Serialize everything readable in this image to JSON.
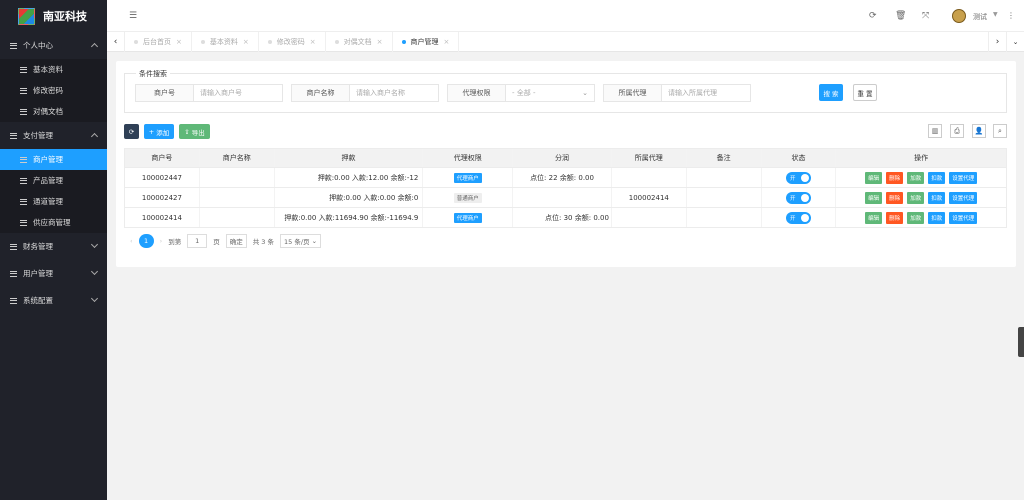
{
  "app": {
    "title": "南亚科技"
  },
  "sidebar": {
    "groups": [
      {
        "label": "个人中心",
        "expanded": true,
        "items": [
          {
            "label": "基本资料"
          },
          {
            "label": "修改密码"
          },
          {
            "label": "对偶文档"
          }
        ]
      },
      {
        "label": "支付管理",
        "expanded": true,
        "items": [
          {
            "label": "商户管理",
            "active": true
          },
          {
            "label": "产品管理"
          },
          {
            "label": "通道管理"
          },
          {
            "label": "供应商管理"
          }
        ]
      },
      {
        "label": "财务管理",
        "expanded": false
      },
      {
        "label": "用户管理",
        "expanded": false
      },
      {
        "label": "系统配置",
        "expanded": false
      }
    ]
  },
  "topbar": {
    "user": "测试"
  },
  "tabs": [
    {
      "label": "后台首页"
    },
    {
      "label": "基本资料"
    },
    {
      "label": "修改密码"
    },
    {
      "label": "对偶文档"
    },
    {
      "label": "商户管理",
      "active": true
    }
  ],
  "search": {
    "legend": "条件搜索",
    "merchant_no": {
      "label": "商户号",
      "placeholder": "请输入商户号"
    },
    "merchant_name": {
      "label": "商户名称",
      "placeholder": "请输入商户名称"
    },
    "agent_perm": {
      "label": "代理权限",
      "value": "- 全部 -"
    },
    "agent": {
      "label": "所属代理",
      "placeholder": "请输入所属代理"
    },
    "search_btn": "搜 索",
    "reset_btn": "重 置"
  },
  "toolbar": {
    "add": "添加",
    "export": "导出"
  },
  "table": {
    "headers": [
      "商户号",
      "商户名称",
      "押款",
      "代理权限",
      "分润",
      "所属代理",
      "备注",
      "状态",
      "操作"
    ],
    "rows": [
      {
        "no": "100002447",
        "name": "",
        "deposit": "押款:0.00 入款:12.00 余额:-12",
        "perm": "代理商户",
        "perm_type": "blue",
        "profit": "点位: 22 余额: 0.00",
        "agent": "",
        "remark": "",
        "status": "开"
      },
      {
        "no": "100002427",
        "name": "",
        "deposit": "押款:0.00 入款:0.00 余额:0",
        "perm": "普通商户",
        "perm_type": "grey",
        "profit": "",
        "agent": "100002414",
        "remark": "",
        "status": "开"
      },
      {
        "no": "100002414",
        "name": "",
        "deposit": "押款:0.00 入款:11694.90 余额:-11694.9",
        "perm": "代理商户",
        "perm_type": "blue",
        "profit": "点位: 30 余额: 0.00",
        "agent": "",
        "remark": "",
        "status": "开"
      }
    ],
    "ops": [
      "编辑",
      "删除",
      "加款",
      "扣款",
      "设置代理"
    ]
  },
  "pager": {
    "current": "1",
    "goto": "到第",
    "page_input": "1",
    "page_unit": "页",
    "confirm": "确定",
    "total": "共 3 条",
    "per_page": "15 条/页"
  }
}
